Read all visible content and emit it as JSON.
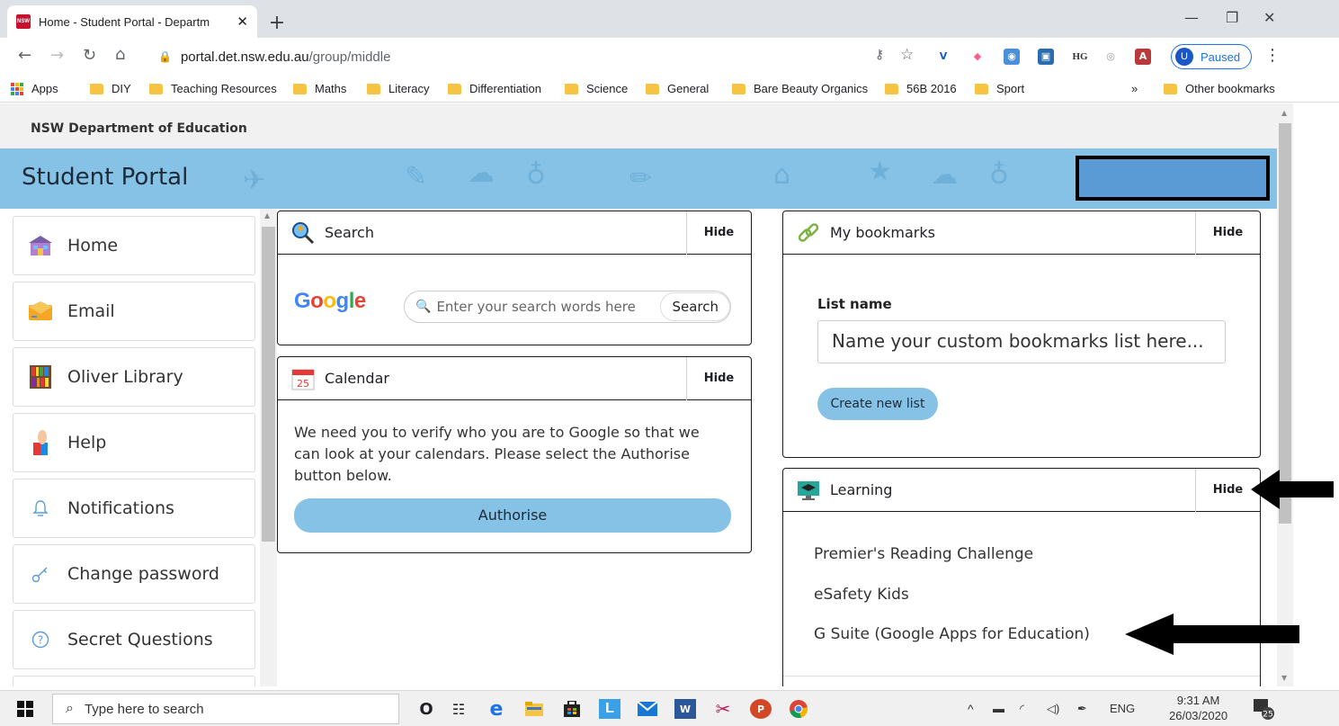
{
  "browser": {
    "tab_title": "Home - Student Portal - Departm",
    "favicon_text": "NSW",
    "tab_close": "✕",
    "new_tab": "+",
    "window_controls": {
      "minimize": "—",
      "restore": "❐",
      "close": "✕"
    },
    "url_host": "portal.det.nsw.edu.au",
    "url_path": "/group/middle",
    "profile_initial": "U",
    "profile_status": "Paused",
    "menu": "⋮",
    "bookmarks": [
      "Apps",
      "DIY",
      "Teaching Resources",
      "Maths",
      "Literacy",
      "Differentiation",
      "Science",
      "General",
      "Bare Beauty Organics",
      "56B 2016",
      "Sport"
    ],
    "bookmarks_overflow": "»",
    "other_bookmarks": "Other bookmarks"
  },
  "portal": {
    "department": "NSW Department of Education",
    "title": "Student Portal",
    "sidebar": [
      {
        "label": "Home",
        "icon": "school-building-icon"
      },
      {
        "label": "Email",
        "icon": "envelope-icon"
      },
      {
        "label": "Oliver Library",
        "icon": "bookshelf-icon"
      },
      {
        "label": "Help",
        "icon": "raised-hand-icon"
      },
      {
        "label": "Notifications",
        "icon": "bell-icon"
      },
      {
        "label": "Change password",
        "icon": "key-icon"
      },
      {
        "label": "Secret Questions",
        "icon": "question-circle-icon"
      }
    ],
    "hide_label": "Hide",
    "search": {
      "title": "Search",
      "google": "Google",
      "placeholder": "Enter your search words here",
      "button": "Search"
    },
    "calendar": {
      "title": "Calendar",
      "icon_day": "25",
      "message": "We need you to verify who you are to Google so that we can look at your calendars. Please select the Authorise button below.",
      "button": "Authorise"
    },
    "bookmarks_widget": {
      "title": "My bookmarks",
      "list_name_label": "List name",
      "list_name_placeholder": "Name your custom bookmarks list here...",
      "create_button": "Create new list"
    },
    "learning": {
      "title": "Learning",
      "links": [
        "Premier's Reading Challenge",
        "eSafety Kids",
        "G Suite (Google Apps for Education)"
      ]
    }
  },
  "taskbar": {
    "search_placeholder": "Type here to search",
    "language": "ENG",
    "time": "9:31 AM",
    "date": "26/03/2020",
    "notifications_count": "25"
  },
  "colors": {
    "banner": "#86c2e6",
    "button": "#86c2e6",
    "redaction_fill": "#5b9bd5",
    "arrow": "#000000"
  }
}
